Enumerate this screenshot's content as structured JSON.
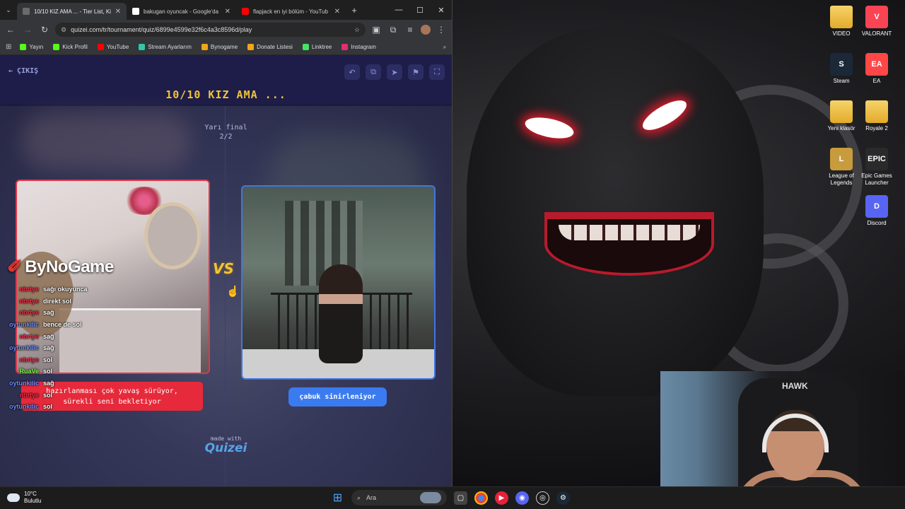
{
  "browser": {
    "tabs": [
      {
        "title": "10/10 KIZ AMA ... - Tier List, Ki",
        "color": "#6b6b6b",
        "active": true
      },
      {
        "title": "bakugan oyuncak - Google'da",
        "color": "#ffffff",
        "active": false
      },
      {
        "title": "flapjack en iyi bölüm - YouTub",
        "color": "#ff0000",
        "active": false
      }
    ],
    "new_tab": "+",
    "url": "quizei.com/tr/tournament/quiz/6899e4599e32f6c4a3c8596d/play",
    "bookmarks": [
      {
        "label": "Yayın",
        "color": "#53fc18"
      },
      {
        "label": "Kick Profil",
        "color": "#53fc18"
      },
      {
        "label": "YouTube",
        "color": "#ff0000"
      },
      {
        "label": "Stream Ayarlarım",
        "color": "#2ec9a6"
      },
      {
        "label": "Bynogame",
        "color": "#f2a51a"
      },
      {
        "label": "Donate Listesi",
        "color": "#f2a51a"
      },
      {
        "label": "Linktree",
        "color": "#43e660"
      },
      {
        "label": "Instagram",
        "color": "#e1306c"
      }
    ]
  },
  "quiz": {
    "exit_label": "ÇIKIŞ",
    "title": "10/10 KIZ AMA ...",
    "round_name": "Yarı final",
    "round_progress": "2/2",
    "left_label_line1": "hazırlanması çok yavaş sürüyor,",
    "left_label_line2": "sürekli seni bekletiyor",
    "right_label": "çabuk sinirleniyor",
    "vs": "VS",
    "made_with": "made with",
    "brand": "Quizei"
  },
  "overlay": {
    "logo": "ByNoGame",
    "chat": [
      {
        "user": "nbrtye",
        "text": "sağı okuyunca",
        "color": "#e8314a"
      },
      {
        "user": "nbrtye",
        "text": "direkt sol",
        "color": "#e8314a"
      },
      {
        "user": "nbrtye",
        "text": "sağ",
        "color": "#e8314a"
      },
      {
        "user": "oytunkilic",
        "text": "bence de sol",
        "color": "#6a8cff"
      },
      {
        "user": "nbrtye",
        "text": "sağ",
        "color": "#e8314a"
      },
      {
        "user": "oytunkilic",
        "text": "sağ",
        "color": "#6a8cff"
      },
      {
        "user": "nbrtye",
        "text": "sol",
        "color": "#e8314a"
      },
      {
        "user": "RuaVe",
        "text": "sol",
        "color": "#7cfc4a"
      },
      {
        "user": "oytunkilic",
        "text": "sağ",
        "color": "#6a8cff"
      },
      {
        "user": "nbrtye",
        "text": "sol",
        "color": "#e8314a"
      },
      {
        "user": "oytunkilic",
        "text": "sol",
        "color": "#6a8cff"
      }
    ]
  },
  "desktop": {
    "icons": [
      {
        "label": "VIDEO",
        "type": "folder"
      },
      {
        "label": "VALORANT",
        "type": "app",
        "color": "#fa4454",
        "glyph": "V"
      },
      {
        "label": "Steam",
        "type": "app",
        "color": "#1b2838",
        "glyph": "S"
      },
      {
        "label": "EA",
        "type": "app",
        "color": "#ff4747",
        "glyph": "EA"
      },
      {
        "label": "Yeni klasör",
        "type": "folder"
      },
      {
        "label": "Royale 2",
        "type": "folder"
      },
      {
        "label": "League of Legends",
        "type": "app",
        "color": "#c89b3c",
        "glyph": "L"
      },
      {
        "label": "Epic Games Launcher",
        "type": "app",
        "color": "#2a2a2a",
        "glyph": "EPIC"
      },
      {
        "label": "Discord",
        "type": "app",
        "color": "#5865f2",
        "glyph": "D"
      }
    ]
  },
  "webcam": {
    "brand": "HAWK"
  },
  "taskbar": {
    "weather_temp": "10°C",
    "weather_desc": "Bulutlu",
    "search_placeholder": "Ara"
  }
}
